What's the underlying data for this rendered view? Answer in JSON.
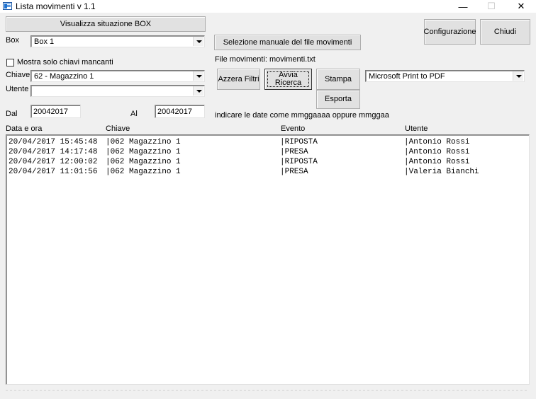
{
  "window": {
    "title": "Lista movimenti v 1.1",
    "minimize_glyph": "—",
    "maximize_glyph": "☐",
    "close_glyph": "✕"
  },
  "buttons": {
    "visualizza": "Visualizza situazione BOX",
    "selezione": "Selezione manuale del file movimenti",
    "azzera": "Azzera Filtri",
    "avvia_line1": "Avvia",
    "avvia_line2": "Ricerca",
    "stampa": "Stampa",
    "esporta": "Esporta",
    "configurazione": "Configurazione",
    "chiudi": "Chiudi"
  },
  "filters": {
    "box_label": "Box",
    "box_value": "Box 1",
    "mostra_label": "Mostra solo chiavi mancanti",
    "mostra_checked": false,
    "chiave_label": "Chiave",
    "chiave_value": "62 - Magazzino 1",
    "utente_label": "Utente",
    "utente_value": "",
    "dal_label": "Dal",
    "dal_value": "20042017",
    "al_label": "Al",
    "al_value": "20042017",
    "date_hint": "indicare le date come mmggaaaa oppure mmggaa"
  },
  "file_info": "File movimenti: movimenti.txt",
  "printer": {
    "value": "Microsoft Print to PDF"
  },
  "list": {
    "headers": {
      "data": "Data e ora",
      "chiave": "Chiave",
      "evento": "Evento",
      "utente": "Utente"
    },
    "rows": [
      {
        "data": "20/04/2017 15:45:48",
        "chiave": "|062 Magazzino 1",
        "evento": "|RIPOSTA",
        "utente": "|Antonio Rossi"
      },
      {
        "data": "20/04/2017 14:17:48",
        "chiave": "|062 Magazzino 1",
        "evento": "|PRESA",
        "utente": "|Antonio Rossi"
      },
      {
        "data": "20/04/2017 12:00:02",
        "chiave": "|062 Magazzino 1",
        "evento": "|RIPOSTA",
        "utente": "|Antonio Rossi"
      },
      {
        "data": "20/04/2017 11:01:56",
        "chiave": "|062 Magazzino 1",
        "evento": "|PRESA",
        "utente": "|Valeria Bianchi"
      }
    ]
  }
}
